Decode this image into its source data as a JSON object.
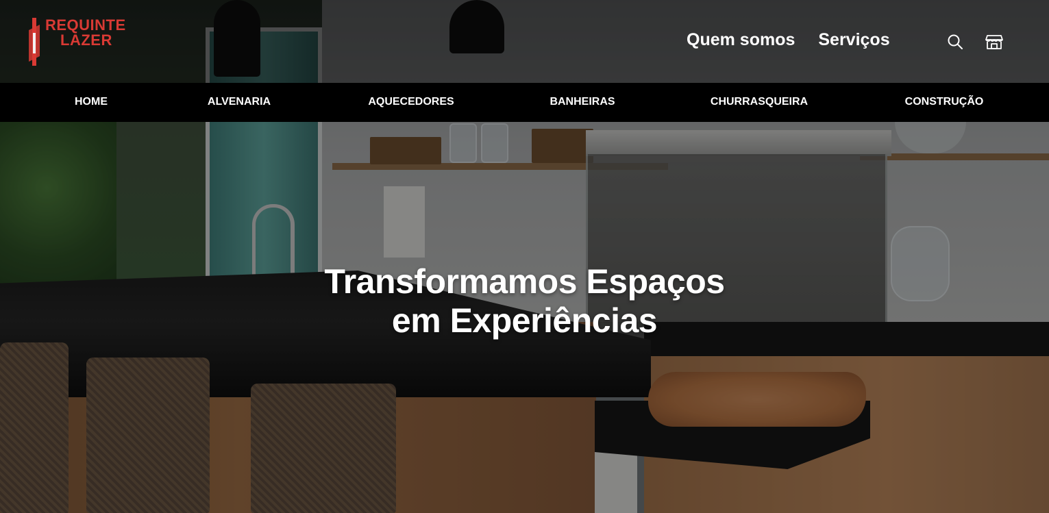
{
  "brand": {
    "logo_line1": "REQUINTE",
    "logo_line2": "LAZER",
    "color": "#d93a34"
  },
  "top_nav": {
    "about_label": "Quem somos",
    "services_label": "Serviços",
    "search_icon": "search-icon",
    "store_icon": "store-icon"
  },
  "category_nav": {
    "items": [
      {
        "label": "HOME"
      },
      {
        "label": "ALVENARIA"
      },
      {
        "label": "AQUECEDORES"
      },
      {
        "label": "BANHEIRAS"
      },
      {
        "label": "CHURRASQUEIRA"
      },
      {
        "label": "CONSTRUÇÃO"
      }
    ]
  },
  "hero": {
    "title_line1": "Transformamos Espaços",
    "title_line2": "em Experiências"
  }
}
